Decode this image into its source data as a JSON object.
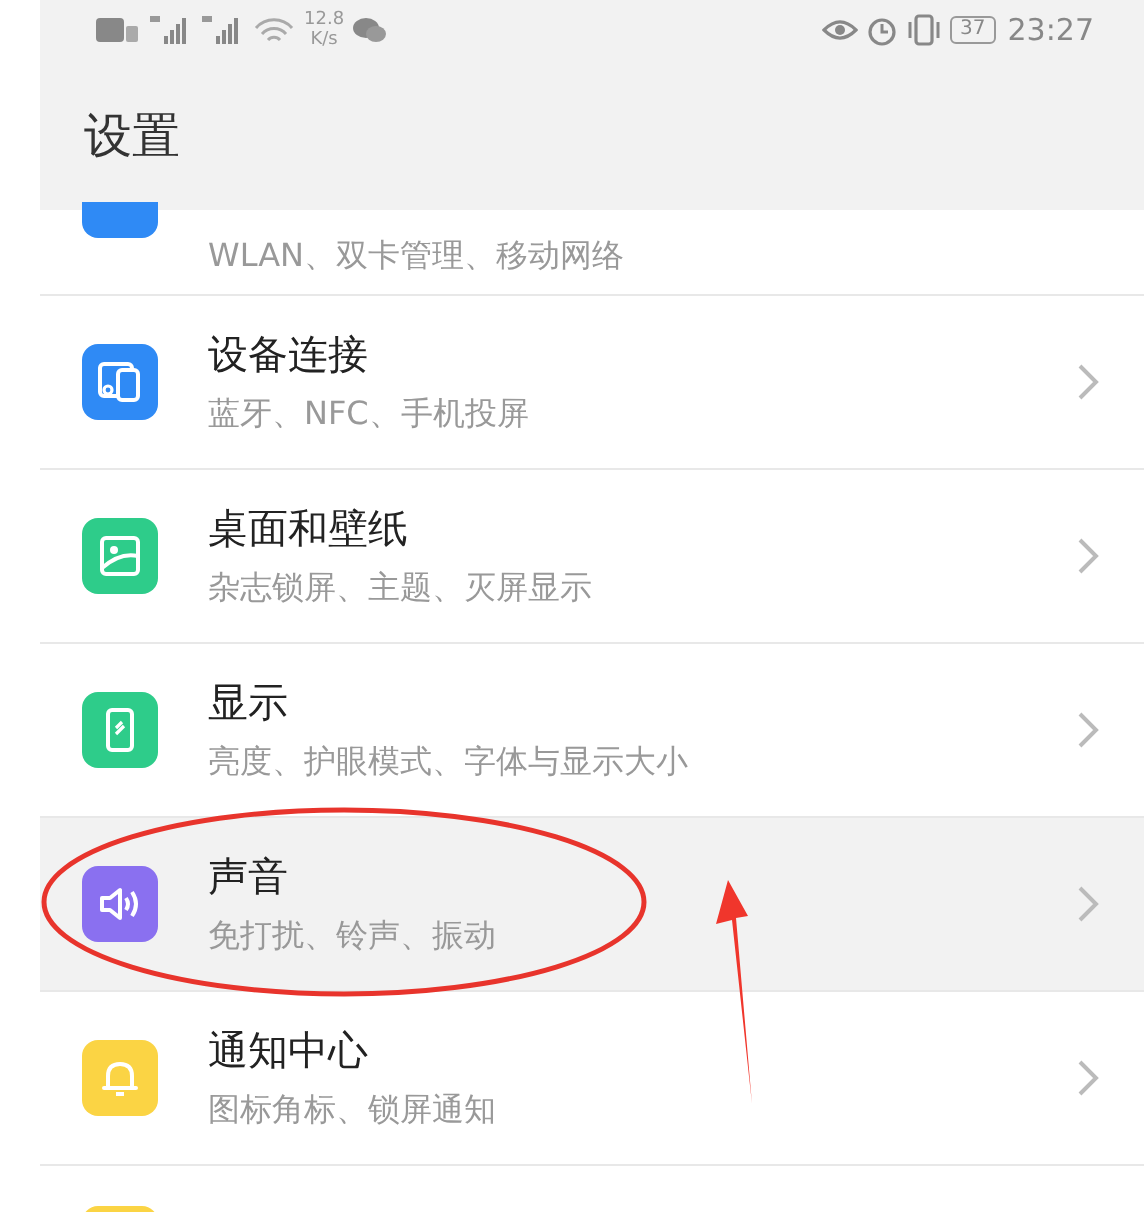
{
  "status_bar": {
    "speed": "12.8",
    "speed_unit": "K/s",
    "battery": "37",
    "time": "23:27"
  },
  "header": {
    "title": "设置"
  },
  "partial_row": {
    "subtitle": "WLAN、双卡管理、移动网络",
    "color": "#2f8af5"
  },
  "rows": [
    {
      "title": "设备连接",
      "subtitle": "蓝牙、NFC、手机投屏",
      "color": "#2f8af5",
      "selected": false
    },
    {
      "title": "桌面和壁纸",
      "subtitle": "杂志锁屏、主题、灭屏显示",
      "color": "#2ecc8a",
      "selected": false
    },
    {
      "title": "显示",
      "subtitle": "亮度、护眼模式、字体与显示大小",
      "color": "#2ecc8a",
      "selected": false
    },
    {
      "title": "声音",
      "subtitle": "免打扰、铃声、振动",
      "color": "#8a70f0",
      "selected": true
    },
    {
      "title": "通知中心",
      "subtitle": "图标角标、锁屏通知",
      "color": "#fbd444",
      "selected": false
    }
  ],
  "cut_row": {
    "color": "#fbd444"
  }
}
